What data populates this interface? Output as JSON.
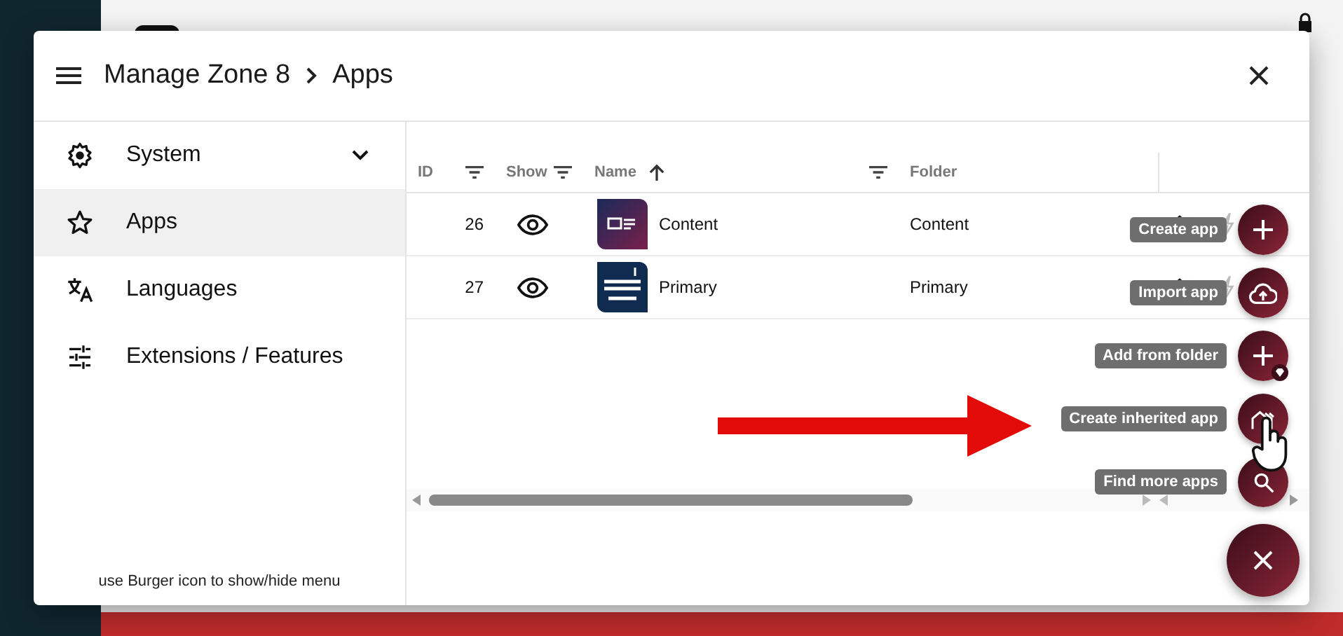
{
  "dialog": {
    "breadcrumb": [
      "Manage Zone 8",
      "Apps"
    ]
  },
  "sidebar": {
    "items": [
      {
        "label": "System",
        "selected": false,
        "expanded": false
      },
      {
        "label": "Apps",
        "selected": true
      },
      {
        "label": "Languages",
        "selected": false
      },
      {
        "label": "Extensions / Features",
        "selected": false
      }
    ],
    "hint": "use Burger icon to show/hide menu"
  },
  "table": {
    "columns": [
      {
        "label": "ID",
        "filter": true
      },
      {
        "label": "Show",
        "filter": true
      },
      {
        "label": "Name",
        "filter": true,
        "sort_ascending": true
      },
      {
        "label": "Folder",
        "filter": false
      }
    ],
    "rows": [
      {
        "id": "26",
        "visible": true,
        "name": "Content",
        "folder": "Content"
      },
      {
        "id": "27",
        "visible": true,
        "name": "Primary",
        "folder": "Primary"
      }
    ]
  },
  "speed_dial": {
    "open": true,
    "actions": [
      {
        "label": "Create app",
        "premium": false
      },
      {
        "label": "Import app",
        "premium": false
      },
      {
        "label": "Add from folder",
        "premium": true
      },
      {
        "label": "Create inherited app",
        "premium": false
      },
      {
        "label": "Find more apps",
        "premium": false
      }
    ]
  }
}
